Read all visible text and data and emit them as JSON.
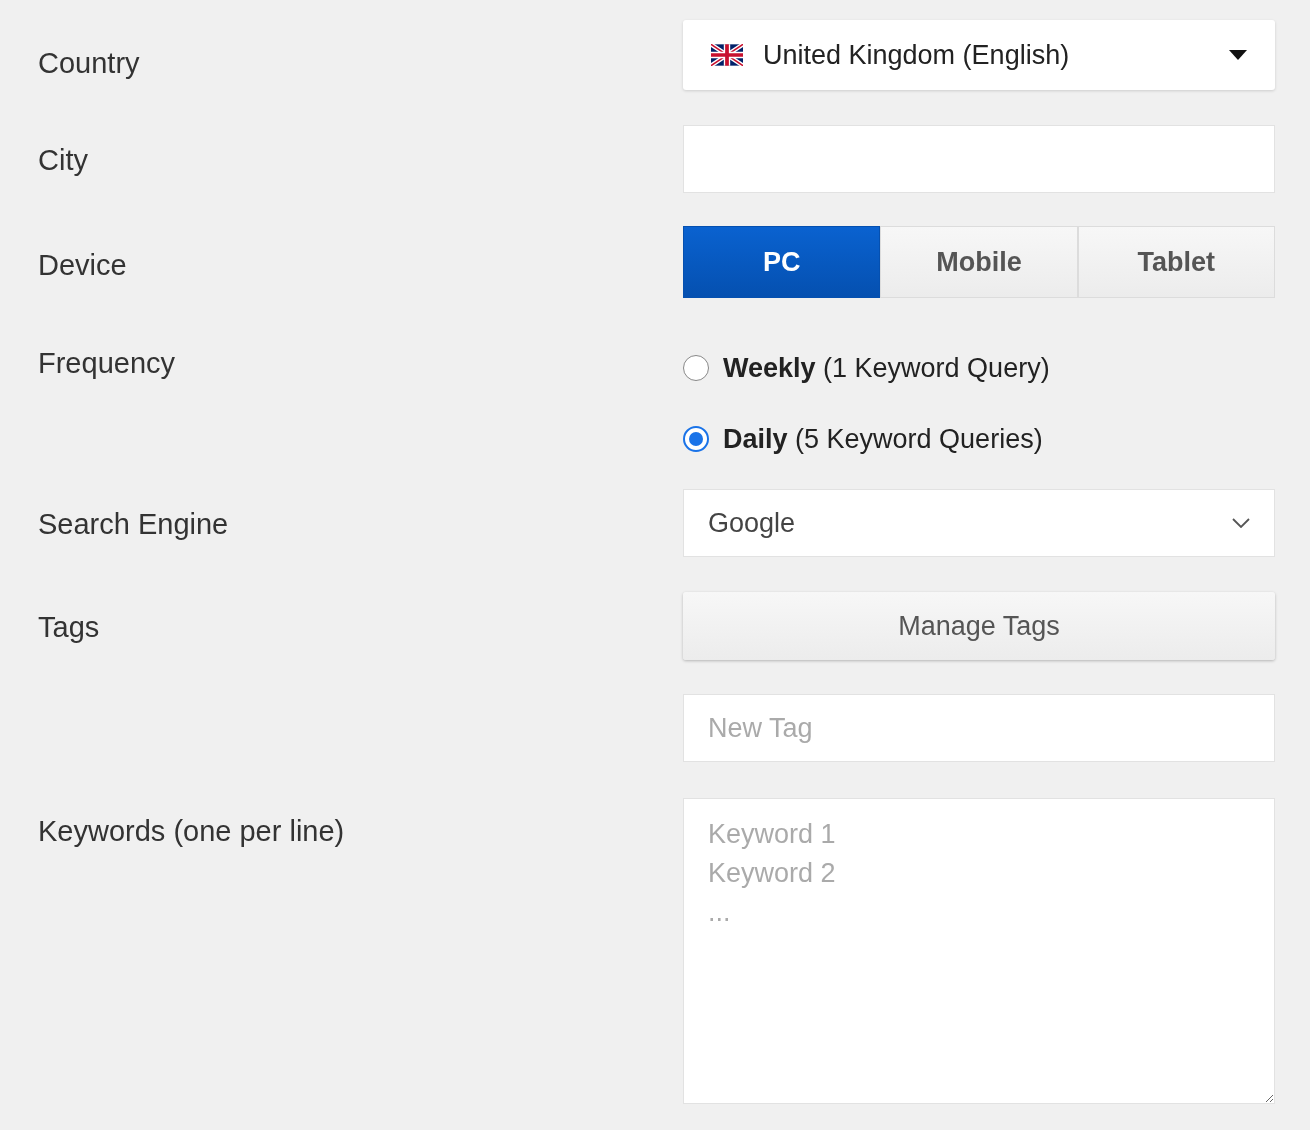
{
  "country": {
    "label": "Country",
    "value": "United Kingdom (English)"
  },
  "city": {
    "label": "City"
  },
  "device": {
    "label": "Device",
    "options": [
      {
        "label": "PC",
        "selected": true
      },
      {
        "label": "Mobile",
        "selected": false
      },
      {
        "label": "Tablet",
        "selected": false
      }
    ]
  },
  "frequency": {
    "label": "Frequency",
    "options": [
      {
        "label": "**Weekly** (1 Keyword Query)",
        "selected": false
      },
      {
        "label": "**Daily** (5 Keyword Queries)",
        "selected": true
      }
    ]
  },
  "search_engine": {
    "label": "Search Engine",
    "value": "Google"
  },
  "tags": {
    "label": "Tags",
    "button": "Manage Tags",
    "new_tag_placeholder": "New Tag"
  },
  "keywords": {
    "label": "Keywords (one per line)",
    "placeholder": "Keyword 1\nKeyword 2\n..."
  }
}
